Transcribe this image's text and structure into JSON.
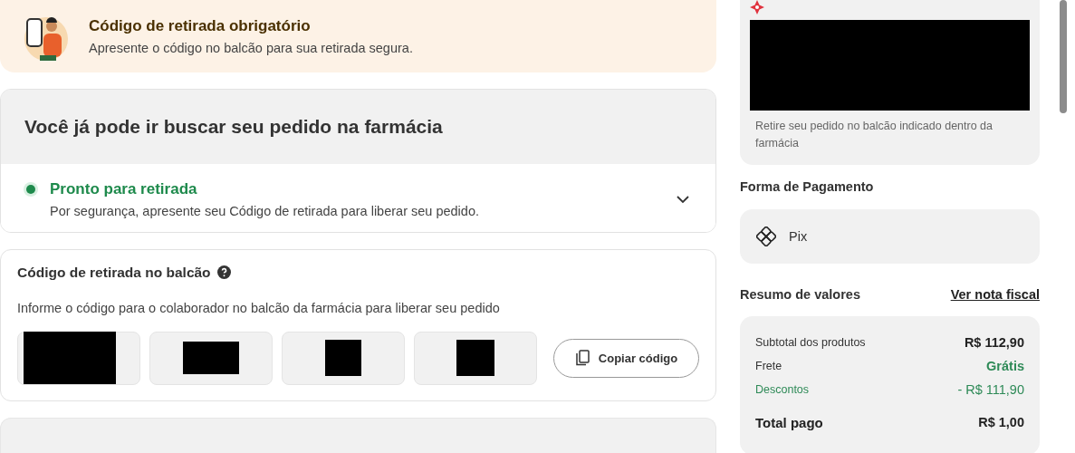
{
  "notice": {
    "title": "Código de retirada obrigatório",
    "text": "Apresente o código no balcão para sua retirada segura."
  },
  "order_status": {
    "heading": "Você já pode ir buscar seu pedido na farmácia",
    "status": "Pronto para retirada",
    "description": "Por segurança, apresente seu Código de retirada para liberar seu pedido.",
    "expanded": false
  },
  "pickup_code": {
    "title": "Código de retirada no balcão",
    "instructions": "Informe o código para o colaborador no balcão da farmácia para liberar seu pedido",
    "copy_button": "Copiar código"
  },
  "pickup_location": {
    "note": "Retire seu pedido no balcão indicado dentro da farmácia"
  },
  "payment": {
    "heading": "Forma de Pagamento",
    "method": "Pix"
  },
  "summary": {
    "heading": "Resumo de valores",
    "invoice_link": "Ver nota fiscal",
    "rows": [
      {
        "kind": "subtotal",
        "label": "Subtotal dos produtos",
        "value": "R$ 112,90"
      },
      {
        "kind": "shipping",
        "label": "Frete",
        "value": "Grátis"
      },
      {
        "kind": "discount",
        "label": "Descontos",
        "value": "- R$ 111,90"
      },
      {
        "kind": "total",
        "label": "Total pago",
        "value": "R$ 1,00"
      }
    ]
  }
}
